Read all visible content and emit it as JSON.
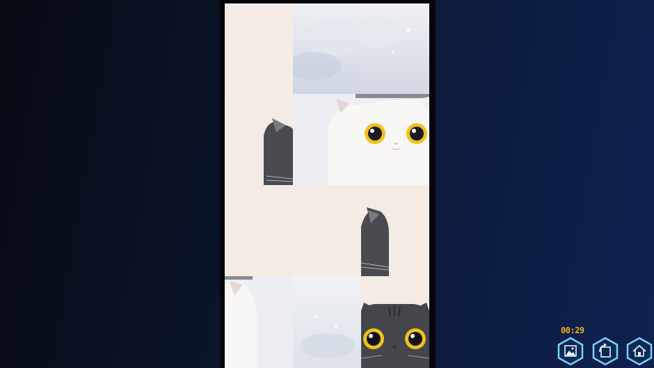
{
  "game": {
    "timer": "00:29",
    "buttons": [
      {
        "name": "preview-image-button",
        "icon": "image-icon"
      },
      {
        "name": "rotate-button",
        "icon": "rotate-icon"
      },
      {
        "name": "home-button",
        "icon": "home-icon"
      }
    ],
    "board": {
      "columns": 3,
      "rows": 4,
      "tiles": [
        {
          "row": 0,
          "col": 0,
          "content": "blank"
        },
        {
          "row": 0,
          "col": 1,
          "content": "sky"
        },
        {
          "row": 0,
          "col": 2,
          "content": "sky"
        },
        {
          "row": 1,
          "col": 0,
          "content": "grey-cat-ear-edge"
        },
        {
          "row": 1,
          "col": 1,
          "content": "white-cat-left-face"
        },
        {
          "row": 1,
          "col": 2,
          "content": "white-cat-right-face"
        },
        {
          "row": 2,
          "col": 0,
          "content": "blank"
        },
        {
          "row": 2,
          "col": 1,
          "content": "blank"
        },
        {
          "row": 2,
          "col": 2,
          "content": "grey-cat-ear"
        },
        {
          "row": 3,
          "col": 0,
          "content": "white-cat-side"
        },
        {
          "row": 3,
          "col": 1,
          "content": "sky-light"
        },
        {
          "row": 3,
          "col": 2,
          "content": "grey-tabby-cat-face"
        }
      ]
    },
    "colors": {
      "timer": "#f2b21b",
      "button_fill": "#0a2a55",
      "button_border": "#7fd0ff",
      "tile_background": "#f4ebe4"
    }
  }
}
